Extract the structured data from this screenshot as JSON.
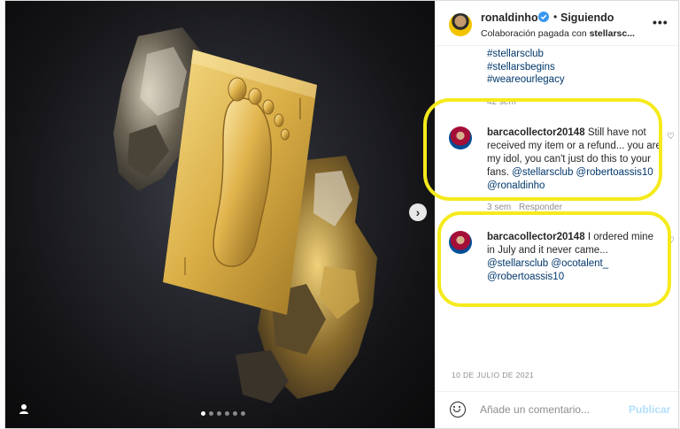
{
  "header": {
    "username": "ronaldinho",
    "separator": "•",
    "follow_label": "Siguiendo",
    "more_label": "•••",
    "collab_prefix": "Colaboración pagada con ",
    "collab_brand": "stellarsc..."
  },
  "caption": {
    "hashtags": [
      "#stellarsclub",
      "#stellarsbegins",
      "#weareourlegacy"
    ],
    "age": "42 sem"
  },
  "comments": [
    {
      "user": "barcacollector20148",
      "text": "Still have not received my item or a refund... you are my idol, you can't just do this to your fans.",
      "mentions": "@stellarsclub @robertoassis10 @ronaldinho",
      "age": "3 sem",
      "reply_label": "Responder"
    },
    {
      "user": "barcacollector20148",
      "text": "I ordered mine in July and it never came...",
      "mentions_line1": "@stellarsclub @ocotalent_",
      "mentions_line2": "@robertoassis10"
    }
  ],
  "date": "10 DE JULIO DE 2021",
  "footer": {
    "placeholder": "Añade un comentario...",
    "publish_label": "Publicar"
  },
  "carousel": {
    "slides": 6,
    "active_index": 0,
    "next_glyph": "›"
  },
  "colors": {
    "highlight": "#f5ea1c",
    "link": "#00376b",
    "verified": "#3897f0",
    "publish": "#b2dffc"
  },
  "icons": [
    "user-tag-icon",
    "verified-icon",
    "emoji-icon",
    "heart-icon",
    "chevron-right-icon"
  ]
}
